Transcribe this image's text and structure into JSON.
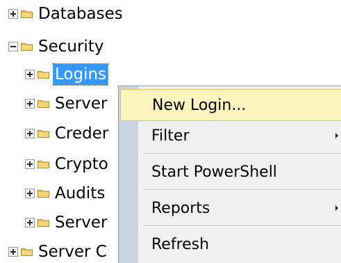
{
  "tree": {
    "items": [
      {
        "label": "Databases",
        "state": "collapsed"
      },
      {
        "label": "Security",
        "state": "expanded"
      },
      {
        "label": "Logins",
        "state": "collapsed",
        "selected": true
      },
      {
        "label": "Server",
        "state": "collapsed"
      },
      {
        "label": "Creder",
        "state": "collapsed"
      },
      {
        "label": "Crypto",
        "state": "collapsed"
      },
      {
        "label": "Audits",
        "state": "collapsed"
      },
      {
        "label": "Server",
        "state": "collapsed"
      },
      {
        "label": "Server C",
        "state": "collapsed"
      }
    ]
  },
  "context_menu": {
    "items": [
      {
        "label": "New Login...",
        "highlighted": true
      },
      {
        "label": "Filter",
        "has_submenu": true
      },
      {
        "label": "Start PowerShell"
      },
      {
        "label": "Reports",
        "has_submenu": true
      },
      {
        "label": "Refresh"
      }
    ]
  },
  "colors": {
    "selection": "#3399ff",
    "folder": "#e8c05a",
    "menu_highlight": "#fdf4bf",
    "menu_gutter": "#c9d4e0"
  },
  "icons": {
    "expand": "plus-box-icon",
    "collapse": "minus-box-icon",
    "folder": "folder-icon",
    "submenu": "chevron-right-icon"
  }
}
